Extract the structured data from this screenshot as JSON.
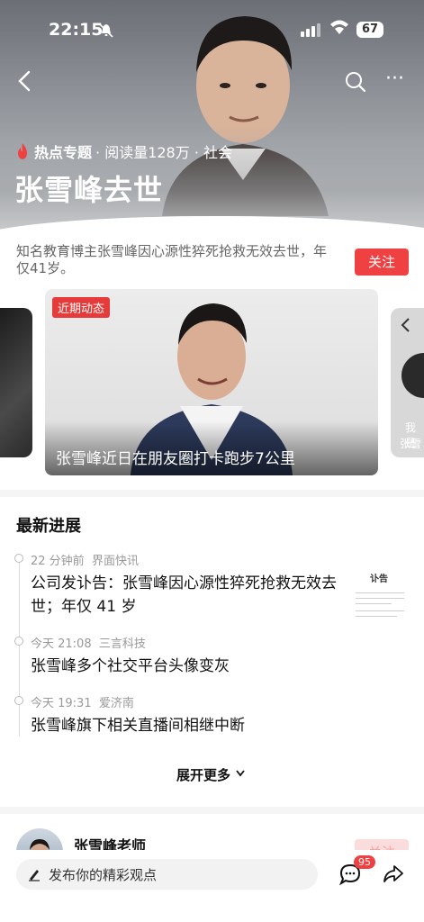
{
  "status_bar": {
    "time": "22:15",
    "battery": "67"
  },
  "topic": {
    "hot_label": "热点专题",
    "meta": "· 阅读量128万 · 社会",
    "title": "张雪峰去世",
    "description": "知名教育博主张雪峰因心源性猝死抢救无效去世，年仅41岁。",
    "follow_label": "关注"
  },
  "carousel": {
    "badge": "近期动态",
    "caption": "张雪峰近日在朋友圈打卡跑步7公里",
    "right_card_text_1": "我是",
    "right_card_text_2": "张雪"
  },
  "latest": {
    "title": "最新进展",
    "items": [
      {
        "time": "22 分钟前",
        "source": "界面快讯",
        "text": "公司发讣告：张雪峰因心源性猝死抢救无效去世；年仅 41 岁"
      },
      {
        "time": "今天 21:08",
        "source": "三言科技",
        "text": "张雪峰多个社交平台头像变灰"
      },
      {
        "time": "今天 19:31",
        "source": "爱济南",
        "text": "张雪峰旗下相关直播间相继中断"
      }
    ],
    "thumb_title": "讣告",
    "expand_label": "展开更多"
  },
  "author": {
    "name": "张雪峰老师",
    "follow_label": "关注"
  },
  "bottom_bar": {
    "placeholder": "发布你的精彩观点",
    "comment_count": "95"
  },
  "colors": {
    "accent": "#f04142"
  }
}
